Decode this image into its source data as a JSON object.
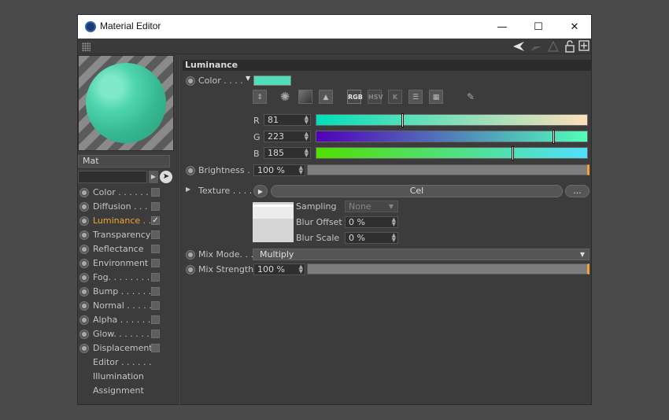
{
  "window": {
    "title": "Material Editor",
    "controls": {
      "minimize": "—",
      "maximize": "☐",
      "close": "✕"
    }
  },
  "material": {
    "name": "Mat",
    "preview_color": "#4fd6ae"
  },
  "channels": [
    {
      "label": "Color . . . . . .",
      "has_radio": true,
      "checkbox": "off"
    },
    {
      "label": "Diffusion . . .",
      "has_radio": true,
      "checkbox": "off"
    },
    {
      "label": "Luminance . .",
      "has_radio": true,
      "checkbox": "on",
      "active": true
    },
    {
      "label": "Transparency",
      "has_radio": true,
      "checkbox": "off"
    },
    {
      "label": "Reflectance",
      "has_radio": true,
      "checkbox": "off"
    },
    {
      "label": "Environment",
      "has_radio": true,
      "checkbox": "off"
    },
    {
      "label": "Fog. . . . . . . .",
      "has_radio": true,
      "checkbox": "off"
    },
    {
      "label": "Bump . . . . . .",
      "has_radio": true,
      "checkbox": "off"
    },
    {
      "label": "Normal . . . . .",
      "has_radio": true,
      "checkbox": "off"
    },
    {
      "label": "Alpha . . . . . .",
      "has_radio": true,
      "checkbox": "off"
    },
    {
      "label": "Glow. . . . . . .",
      "has_radio": true,
      "checkbox": "off"
    },
    {
      "label": "Displacement",
      "has_radio": true,
      "checkbox": "off"
    },
    {
      "label": "Editor . . . . . .",
      "has_radio": false
    },
    {
      "label": "Illumination",
      "has_radio": false
    },
    {
      "label": "Assignment",
      "has_radio": false
    }
  ],
  "luminance": {
    "header": "Luminance",
    "color_label": "Color . . . .",
    "swatch_color": "#51dfb9",
    "color_modes": [
      "RGB",
      "HSV",
      "K"
    ],
    "rgb": [
      {
        "label": "R",
        "value": "81",
        "fraction": 0.318
      },
      {
        "label": "G",
        "value": "223",
        "fraction": 0.874
      },
      {
        "label": "B",
        "value": "185",
        "fraction": 0.725
      }
    ],
    "brightness_label": "Brightness . .",
    "brightness_value": "100 %",
    "brightness_level": 1.0,
    "texture_label": "Texture . . . . .",
    "texture_name": "Cel",
    "texture_more": "...",
    "sampling_label": "Sampling",
    "sampling_value": "None",
    "blur_offset_label": "Blur Offset",
    "blur_offset_value": "0 %",
    "blur_scale_label": "Blur Scale",
    "blur_scale_value": "0 %",
    "mix_mode_label": "Mix Mode. . .",
    "mix_mode_value": "Multiply",
    "mix_strength_label": "Mix Strength",
    "mix_strength_value": "100 %",
    "mix_strength_level": 1.0
  },
  "colors": {
    "accent": "#f3a333",
    "panel": "#3c3c3c"
  }
}
